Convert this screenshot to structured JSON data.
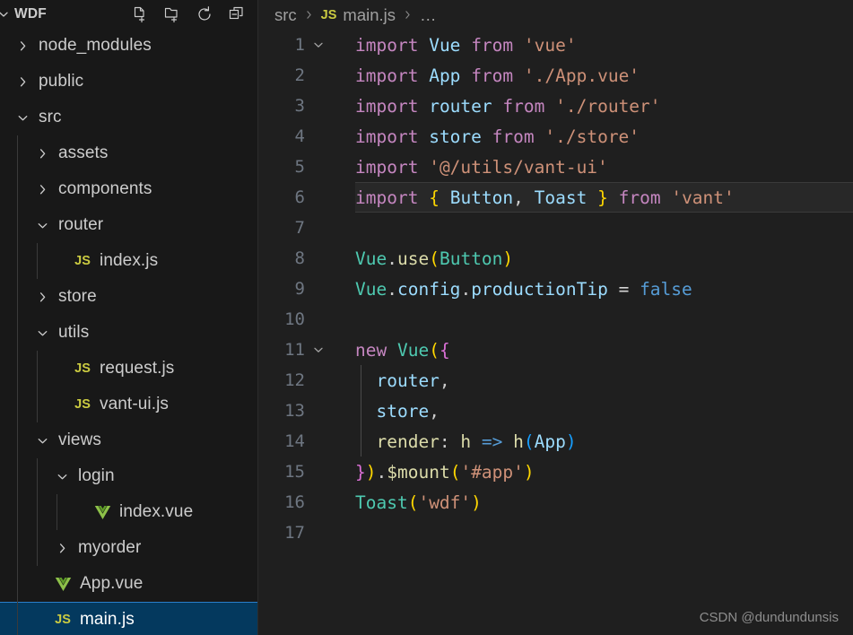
{
  "theme": {
    "sidebar_bg": "#181818",
    "editor_bg": "#1f1f1f",
    "selection_bg": "#04395e",
    "selection_border": "#2a7ecb",
    "active_line_bg": "#282828",
    "text": "#cccccc",
    "line_number": "#6e7681",
    "js_icon": "#cbcb41",
    "vue_icon": "#8dc149"
  },
  "sidebar": {
    "title": "WDF",
    "title_chevron": "chevron-down",
    "actions": [
      {
        "name": "new-file",
        "tooltip": "New File"
      },
      {
        "name": "new-folder",
        "tooltip": "New Folder"
      },
      {
        "name": "refresh-explorer",
        "tooltip": "Refresh Explorer"
      },
      {
        "name": "collapse-folders",
        "tooltip": "Collapse Folders in Explorer"
      }
    ],
    "tree": [
      {
        "label": "node_modules",
        "type": "folder",
        "state": "collapsed",
        "depth": 0,
        "selected": false
      },
      {
        "label": "public",
        "type": "folder",
        "state": "collapsed",
        "depth": 0,
        "selected": false
      },
      {
        "label": "src",
        "type": "folder",
        "state": "expanded",
        "depth": 0,
        "selected": false
      },
      {
        "label": "assets",
        "type": "folder",
        "state": "collapsed",
        "depth": 1,
        "selected": false
      },
      {
        "label": "components",
        "type": "folder",
        "state": "collapsed",
        "depth": 1,
        "selected": false
      },
      {
        "label": "router",
        "type": "folder",
        "state": "expanded",
        "depth": 1,
        "selected": false
      },
      {
        "label": "index.js",
        "type": "js",
        "state": "leaf",
        "depth": 2,
        "selected": false
      },
      {
        "label": "store",
        "type": "folder",
        "state": "collapsed",
        "depth": 1,
        "selected": false
      },
      {
        "label": "utils",
        "type": "folder",
        "state": "expanded",
        "depth": 1,
        "selected": false
      },
      {
        "label": "request.js",
        "type": "js",
        "state": "leaf",
        "depth": 2,
        "selected": false
      },
      {
        "label": "vant-ui.js",
        "type": "js",
        "state": "leaf",
        "depth": 2,
        "selected": false
      },
      {
        "label": "views",
        "type": "folder",
        "state": "expanded",
        "depth": 1,
        "selected": false
      },
      {
        "label": "login",
        "type": "folder",
        "state": "expanded",
        "depth": 2,
        "selected": false
      },
      {
        "label": "index.vue",
        "type": "vue",
        "state": "leaf",
        "depth": 3,
        "selected": false
      },
      {
        "label": "myorder",
        "type": "folder",
        "state": "collapsed",
        "depth": 2,
        "selected": false
      },
      {
        "label": "App.vue",
        "type": "vue",
        "state": "leaf",
        "depth": 1,
        "selected": false
      },
      {
        "label": "main.js",
        "type": "js",
        "state": "leaf",
        "depth": 1,
        "selected": true
      }
    ]
  },
  "breadcrumb": [
    {
      "label": "src",
      "icon": null
    },
    {
      "label": "main.js",
      "icon": "JS"
    },
    {
      "label": "…",
      "icon": null
    }
  ],
  "editor": {
    "active_line": 6,
    "lines": [
      {
        "n": 1,
        "fold": "open",
        "tokens": [
          {
            "t": "import",
            "c": "t-kw"
          },
          {
            "t": " ",
            "c": "t-punct"
          },
          {
            "t": "Vue",
            "c": "t-var"
          },
          {
            "t": " ",
            "c": "t-punct"
          },
          {
            "t": "from",
            "c": "t-kw"
          },
          {
            "t": " ",
            "c": "t-punct"
          },
          {
            "t": "'vue'",
            "c": "t-str"
          }
        ]
      },
      {
        "n": 2,
        "fold": null,
        "tokens": [
          {
            "t": "import",
            "c": "t-kw"
          },
          {
            "t": " ",
            "c": "t-punct"
          },
          {
            "t": "App",
            "c": "t-var"
          },
          {
            "t": " ",
            "c": "t-punct"
          },
          {
            "t": "from",
            "c": "t-kw"
          },
          {
            "t": " ",
            "c": "t-punct"
          },
          {
            "t": "'./App.vue'",
            "c": "t-str"
          }
        ]
      },
      {
        "n": 3,
        "fold": null,
        "tokens": [
          {
            "t": "import",
            "c": "t-kw"
          },
          {
            "t": " ",
            "c": "t-punct"
          },
          {
            "t": "router",
            "c": "t-var"
          },
          {
            "t": " ",
            "c": "t-punct"
          },
          {
            "t": "from",
            "c": "t-kw"
          },
          {
            "t": " ",
            "c": "t-punct"
          },
          {
            "t": "'./router'",
            "c": "t-str"
          }
        ]
      },
      {
        "n": 4,
        "fold": null,
        "tokens": [
          {
            "t": "import",
            "c": "t-kw"
          },
          {
            "t": " ",
            "c": "t-punct"
          },
          {
            "t": "store",
            "c": "t-var"
          },
          {
            "t": " ",
            "c": "t-punct"
          },
          {
            "t": "from",
            "c": "t-kw"
          },
          {
            "t": " ",
            "c": "t-punct"
          },
          {
            "t": "'./store'",
            "c": "t-str"
          }
        ]
      },
      {
        "n": 5,
        "fold": null,
        "tokens": [
          {
            "t": "import",
            "c": "t-kw"
          },
          {
            "t": " ",
            "c": "t-punct"
          },
          {
            "t": "'@/utils/vant-ui'",
            "c": "t-str"
          }
        ]
      },
      {
        "n": 6,
        "fold": null,
        "tokens": [
          {
            "t": "import",
            "c": "t-kw"
          },
          {
            "t": " ",
            "c": "t-punct"
          },
          {
            "t": "{",
            "c": "t-br1"
          },
          {
            "t": " ",
            "c": "t-punct"
          },
          {
            "t": "Button",
            "c": "t-var"
          },
          {
            "t": ",",
            "c": "t-punct"
          },
          {
            "t": " ",
            "c": "t-punct"
          },
          {
            "t": "Toast",
            "c": "t-var"
          },
          {
            "t": " ",
            "c": "t-punct"
          },
          {
            "t": "}",
            "c": "t-br1"
          },
          {
            "t": " ",
            "c": "t-punct"
          },
          {
            "t": "from",
            "c": "t-kw"
          },
          {
            "t": " ",
            "c": "t-punct"
          },
          {
            "t": "'vant'",
            "c": "t-str"
          }
        ]
      },
      {
        "n": 7,
        "fold": null,
        "tokens": []
      },
      {
        "n": 8,
        "fold": null,
        "tokens": [
          {
            "t": "Vue",
            "c": "t-obj"
          },
          {
            "t": ".",
            "c": "t-punct"
          },
          {
            "t": "use",
            "c": "t-fn"
          },
          {
            "t": "(",
            "c": "t-br1"
          },
          {
            "t": "Button",
            "c": "t-obj"
          },
          {
            "t": ")",
            "c": "t-br1"
          }
        ]
      },
      {
        "n": 9,
        "fold": null,
        "tokens": [
          {
            "t": "Vue",
            "c": "t-obj"
          },
          {
            "t": ".",
            "c": "t-punct"
          },
          {
            "t": "config",
            "c": "t-var"
          },
          {
            "t": ".",
            "c": "t-punct"
          },
          {
            "t": "productionTip",
            "c": "t-var"
          },
          {
            "t": " ",
            "c": "t-punct"
          },
          {
            "t": "=",
            "c": "t-op"
          },
          {
            "t": " ",
            "c": "t-punct"
          },
          {
            "t": "false",
            "c": "t-arrow"
          }
        ]
      },
      {
        "n": 10,
        "fold": null,
        "tokens": []
      },
      {
        "n": 11,
        "fold": "open",
        "tokens": [
          {
            "t": "new",
            "c": "t-kw"
          },
          {
            "t": " ",
            "c": "t-punct"
          },
          {
            "t": "Vue",
            "c": "t-obj"
          },
          {
            "t": "(",
            "c": "t-br1"
          },
          {
            "t": "{",
            "c": "t-br2"
          }
        ]
      },
      {
        "n": 12,
        "fold": null,
        "indent": 1,
        "tokens": [
          {
            "t": "  router",
            "c": "t-var"
          },
          {
            "t": ",",
            "c": "t-punct"
          }
        ]
      },
      {
        "n": 13,
        "fold": null,
        "indent": 1,
        "tokens": [
          {
            "t": "  store",
            "c": "t-var"
          },
          {
            "t": ",",
            "c": "t-punct"
          }
        ]
      },
      {
        "n": 14,
        "fold": null,
        "indent": 1,
        "tokens": [
          {
            "t": "  render",
            "c": "t-fn"
          },
          {
            "t": ":",
            "c": "t-punct"
          },
          {
            "t": " ",
            "c": "t-punct"
          },
          {
            "t": "h",
            "c": "t-fn"
          },
          {
            "t": " ",
            "c": "t-punct"
          },
          {
            "t": "=>",
            "c": "t-arrow"
          },
          {
            "t": " ",
            "c": "t-punct"
          },
          {
            "t": "h",
            "c": "t-fn"
          },
          {
            "t": "(",
            "c": "t-br3"
          },
          {
            "t": "App",
            "c": "t-var"
          },
          {
            "t": ")",
            "c": "t-br3"
          }
        ]
      },
      {
        "n": 15,
        "fold": null,
        "tokens": [
          {
            "t": "}",
            "c": "t-br2"
          },
          {
            "t": ")",
            "c": "t-br1"
          },
          {
            "t": ".",
            "c": "t-punct"
          },
          {
            "t": "$mount",
            "c": "t-fn"
          },
          {
            "t": "(",
            "c": "t-br1"
          },
          {
            "t": "'#app'",
            "c": "t-str"
          },
          {
            "t": ")",
            "c": "t-br1"
          }
        ]
      },
      {
        "n": 16,
        "fold": null,
        "tokens": [
          {
            "t": "Toast",
            "c": "t-obj"
          },
          {
            "t": "(",
            "c": "t-br1"
          },
          {
            "t": "'wdf'",
            "c": "t-str"
          },
          {
            "t": ")",
            "c": "t-br1"
          }
        ]
      },
      {
        "n": 17,
        "fold": null,
        "tokens": []
      }
    ]
  },
  "watermark": "CSDN @dundundunsis"
}
